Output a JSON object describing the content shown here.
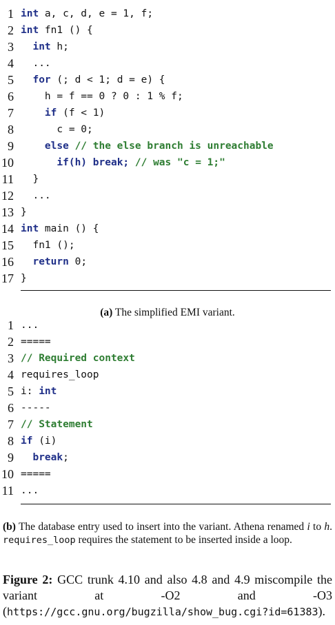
{
  "listing_a": [
    {
      "n": "1",
      "tokens": [
        {
          "t": "int",
          "c": "kw"
        },
        {
          "t": " a, c, d, e = 1, f;"
        }
      ]
    },
    {
      "n": "2",
      "tokens": [
        {
          "t": "int",
          "c": "kw"
        },
        {
          "t": " fn1 () {"
        }
      ]
    },
    {
      "n": "3",
      "tokens": [
        {
          "t": "  "
        },
        {
          "t": "int",
          "c": "kw"
        },
        {
          "t": " h;"
        }
      ]
    },
    {
      "n": "4",
      "tokens": [
        {
          "t": "  ..."
        }
      ]
    },
    {
      "n": "5",
      "tokens": [
        {
          "t": "  "
        },
        {
          "t": "for",
          "c": "kw"
        },
        {
          "t": " (; d < 1; d = e) {"
        }
      ]
    },
    {
      "n": "6",
      "tokens": [
        {
          "t": "    h = f == 0 ? 0 : 1 % f;"
        }
      ]
    },
    {
      "n": "7",
      "tokens": [
        {
          "t": "    "
        },
        {
          "t": "if",
          "c": "kw"
        },
        {
          "t": " (f < 1)"
        }
      ]
    },
    {
      "n": "8",
      "tokens": [
        {
          "t": "      c = 0;"
        }
      ]
    },
    {
      "n": "9",
      "tokens": [
        {
          "t": "    "
        },
        {
          "t": "else",
          "c": "kw"
        },
        {
          "t": " "
        },
        {
          "t": "// the else branch is unreachable",
          "c": "cm"
        }
      ]
    },
    {
      "n": "10",
      "tokens": [
        {
          "t": "      "
        },
        {
          "t": "if(h) break;",
          "c": "st"
        },
        {
          "t": " "
        },
        {
          "t": "// was \"c = 1;\"",
          "c": "cm"
        }
      ]
    },
    {
      "n": "11",
      "tokens": [
        {
          "t": "  }"
        }
      ]
    },
    {
      "n": "12",
      "tokens": [
        {
          "t": "  ..."
        }
      ]
    },
    {
      "n": "13",
      "tokens": [
        {
          "t": "}"
        }
      ]
    },
    {
      "n": "14",
      "tokens": [
        {
          "t": "int",
          "c": "kw"
        },
        {
          "t": " main () {"
        }
      ]
    },
    {
      "n": "15",
      "tokens": [
        {
          "t": "  fn1 ();"
        }
      ]
    },
    {
      "n": "16",
      "tokens": [
        {
          "t": "  "
        },
        {
          "t": "return",
          "c": "kw"
        },
        {
          "t": " 0;"
        }
      ]
    },
    {
      "n": "17",
      "tokens": [
        {
          "t": "}"
        }
      ]
    }
  ],
  "caption_a": {
    "label": "(a)",
    "text": " The simplified EMI variant."
  },
  "listing_b": [
    {
      "n": "1",
      "tokens": [
        {
          "t": "..."
        }
      ]
    },
    {
      "n": "2",
      "tokens": [
        {
          "t": "====="
        }
      ]
    },
    {
      "n": "3",
      "tokens": [
        {
          "t": "// Required context",
          "c": "cm"
        }
      ]
    },
    {
      "n": "4",
      "tokens": [
        {
          "t": "requires_loop"
        }
      ]
    },
    {
      "n": "5",
      "tokens": [
        {
          "t": "i: "
        },
        {
          "t": "int",
          "c": "kw"
        }
      ]
    },
    {
      "n": "6",
      "tokens": [
        {
          "t": "-----"
        }
      ]
    },
    {
      "n": "7",
      "tokens": [
        {
          "t": "// Statement",
          "c": "cm"
        }
      ]
    },
    {
      "n": "8",
      "tokens": [
        {
          "t": "if",
          "c": "kw"
        },
        {
          "t": " (i)"
        }
      ]
    },
    {
      "n": "9",
      "tokens": [
        {
          "t": "  "
        },
        {
          "t": "break",
          "c": "kw"
        },
        {
          "t": ";"
        }
      ]
    },
    {
      "n": "10",
      "tokens": [
        {
          "t": "====="
        }
      ]
    },
    {
      "n": "11",
      "tokens": [
        {
          "t": "..."
        }
      ]
    }
  ],
  "caption_b": {
    "label": "(b)",
    "text1": " The database entry used to insert into the variant. Athena renamed ",
    "var_i": "i",
    "text2": " to ",
    "var_h": "h",
    "text3": ". ",
    "code": "requires_loop",
    "text4": " requires the statement to be inserted inside a loop."
  },
  "figure": {
    "label": "Figure 2:",
    "text": " GCC trunk 4.10 and also 4.8 and 4.9 miscompile the variant at -O2 and -O3 (",
    "url": "https://gcc.gnu.org/bugzilla/show_bug.cgi?id=61383",
    "tail": ")."
  }
}
